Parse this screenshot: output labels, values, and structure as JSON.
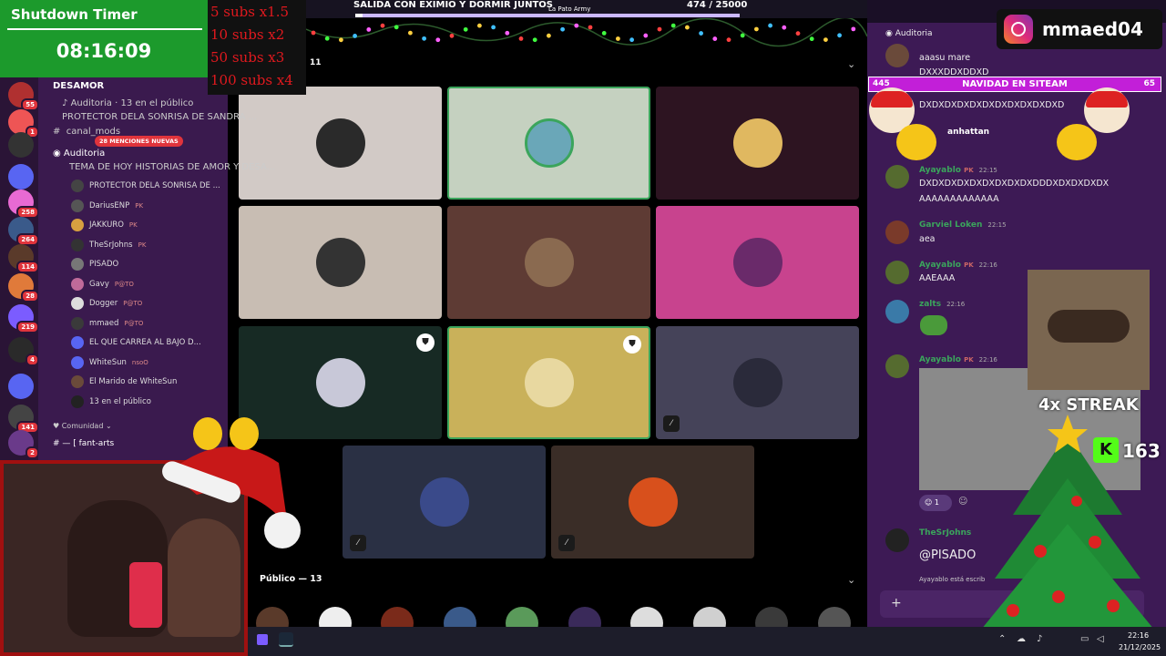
{
  "timer": {
    "title": "Shutdown Timer",
    "value": "08:16:09"
  },
  "subs": [
    "5 subs x1.5",
    "10 subs x2",
    "50 subs x3",
    "100 subs x4"
  ],
  "goal": {
    "title": "SALIDA CON EXIMIO Y DORMIR JUNTOS",
    "subtitle": "La Pato Army",
    "count": "474  / 25000",
    "progress": 0.019
  },
  "server_badges": [
    "55",
    "1",
    "258",
    "264",
    "114",
    "28",
    "219",
    "4",
    "141",
    "2"
  ],
  "channels": {
    "category": "DESAMOR",
    "auditoria_small": "Auditoria",
    "in_public_small": "13 en el público",
    "protector_small": "PROTECTOR DELA SONRISA DE SANDRA ...",
    "canal": "canal_mods",
    "mentions_badge": "28 MENCIONES NUEVAS",
    "auditoria": "Auditoria",
    "topic": "TEMA DE HOY HISTORIAS DE AMOR Y DESA...",
    "members": [
      {
        "name": "PROTECTOR DELA SONRISA DE ...",
        "tag": ""
      },
      {
        "name": "DariusENP",
        "tag": "PK"
      },
      {
        "name": "JAKKURO",
        "tag": "PK"
      },
      {
        "name": "TheSrJohns",
        "tag": "PK"
      },
      {
        "name": "PISADO",
        "tag": ""
      },
      {
        "name": "Gavy",
        "tag": "P@TO"
      },
      {
        "name": "Dogger",
        "tag": "P@TO"
      },
      {
        "name": "mmaed",
        "tag": "P@TO"
      },
      {
        "name": "EL QUE CARREA AL BAJO D...",
        "tag": ""
      },
      {
        "name": "WhiteSun",
        "tag": "nsoO"
      },
      {
        "name": "El Marido de WhiteSun",
        "tag": ""
      },
      {
        "name": "13 en el público",
        "tag": ""
      }
    ],
    "comunidad": "Comunidad",
    "fant_arts": "fant-arts"
  },
  "stage": {
    "speakers_count": "11",
    "public_label": "Público — 13"
  },
  "tile_colors": [
    "#d2cac6",
    "#c5d1c0",
    "#2d1421",
    "#c8bdb3",
    "#5e3b34",
    "#c8438e",
    "#172a24",
    "#c9b15a",
    "#454359",
    "#2a3044",
    "#3a2d27"
  ],
  "public_colors": [
    "#5a3a2a",
    "#eeeeee",
    "#7a2a1a",
    "#3a5a8a",
    "#5a9a5a",
    "#3a2a5a",
    "#dddddd",
    "#d0d0d0",
    "#3a3a3a",
    "#555555",
    "#f0f0f0"
  ],
  "chat": {
    "header": "Auditoria",
    "msg1": "aaasu mare",
    "msg2": "DXXXDDXDDXD",
    "navidad": {
      "left": "445",
      "label": "NAVIDAD EN SITEAM",
      "right": "65"
    },
    "msg3": "DXDXDXDXDXDXDXDXDXDXDXD",
    "msg4_name": "anhattan",
    "msg5_name": "Ayayablo",
    "msg5_tag": "PK",
    "msg5_time": "22:15",
    "msg5_text": "DXDXDXDXDXDXDXDXDXDDDXDXDXDXDX",
    "msg5_text2": "AAAAAAAAAAAAA",
    "msg6_name": "Garviel Loken",
    "msg6_time": "22:15",
    "msg6_text": "aea",
    "msg7_name": "Ayayablo",
    "msg7_tag": "PK",
    "msg7_time": "22:16",
    "msg7_text": "AAEAAA",
    "msg8_name": "zalts",
    "msg8_time": "22:16",
    "msg9_name": "Ayayablo",
    "msg9_tag": "PK",
    "msg9_time": "22:16",
    "reaction_count": "1",
    "msg10_name": "TheSrJohns",
    "msg10_text": "@PISADO",
    "typing": "Ayayablo está escrib"
  },
  "instagram": {
    "handle": "mmaed04"
  },
  "streak": {
    "label": "4x STREAK",
    "count": "163"
  },
  "taskbar": {
    "time": "22:16",
    "date": "21/12/2025"
  }
}
